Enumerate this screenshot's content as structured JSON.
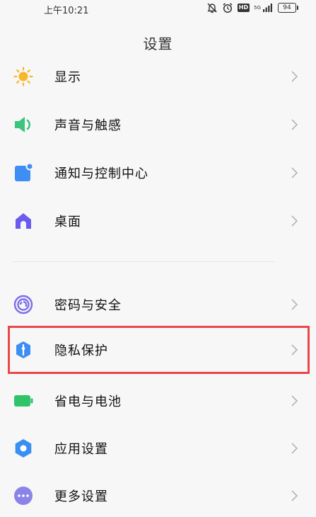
{
  "status_bar": {
    "time": "上午10:21",
    "network": "5G",
    "hd": "HD",
    "battery": "94"
  },
  "header": {
    "title": "设置"
  },
  "items": [
    {
      "label": "显示",
      "icon": "sun-icon"
    },
    {
      "label": "声音与触感",
      "icon": "speaker-icon"
    },
    {
      "label": "通知与控制中心",
      "icon": "notification-icon"
    },
    {
      "label": "桌面",
      "icon": "home-icon"
    },
    {
      "label": "密码与安全",
      "icon": "fingerprint-icon"
    },
    {
      "label": "隐私保护",
      "icon": "privacy-shield-icon"
    },
    {
      "label": "省电与电池",
      "icon": "battery-icon"
    },
    {
      "label": "应用设置",
      "icon": "gear-icon"
    },
    {
      "label": "更多设置",
      "icon": "more-dots-icon"
    }
  ],
  "colors": {
    "sun": "#f5b82a",
    "speaker": "#3bc47c",
    "notification": "#3f8ef5",
    "home": "#6b5cf0",
    "fingerprint": "#7a6ee8",
    "privacy": "#3d8ef2",
    "battery": "#2fc46a",
    "gear": "#3a8ff2",
    "more": "#8b84e8",
    "highlight": "#e8484a"
  }
}
